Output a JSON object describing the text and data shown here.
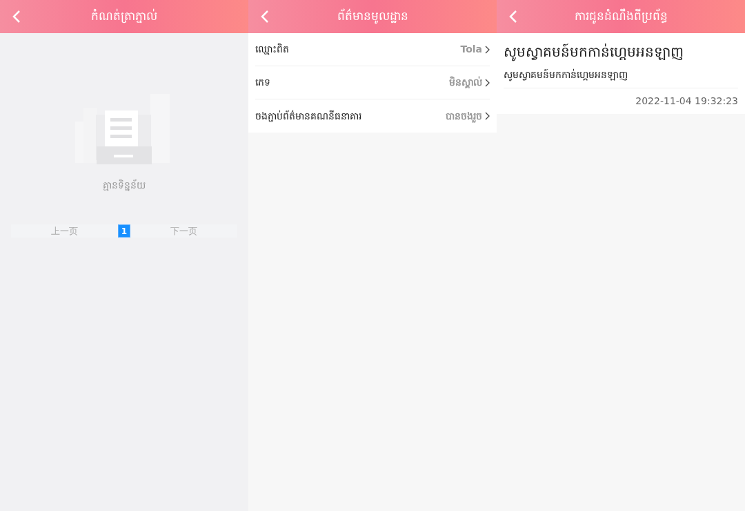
{
  "panels": [
    {
      "kind": "empty",
      "title": "កំណត់ត្រាភ្នាល់",
      "empty_text": "គ្មានទិន្នន័យ",
      "pagination": {
        "prev": "上一页",
        "pages": [
          {
            "label": "1",
            "selected": true
          }
        ],
        "next": "下一页"
      }
    },
    {
      "kind": "list",
      "title": "ព័ត៌មានមូលដ្ឋាន",
      "rows": [
        {
          "label": "ឈ្មោះពិត",
          "value": "Tola"
        },
        {
          "label": "ភេទ",
          "value": "មិនស្គាល់"
        },
        {
          "label": "ចងភ្ជាប់ព័ត៌មានគណនីធនាគារ",
          "value": "បានចងរួច"
        }
      ]
    },
    {
      "kind": "notice",
      "title": "ការជូនដំណឹងពីប្រព័ន្ធ",
      "notice": {
        "heading": "សូមស្វាគមន៍មកកាន់ហ្គេមអនឡាញ",
        "body": "សូមស្វាគមន៍មកកាន់ហ្គេមអនឡាញ",
        "time": "2022-11-04 19:32:23"
      }
    }
  ]
}
